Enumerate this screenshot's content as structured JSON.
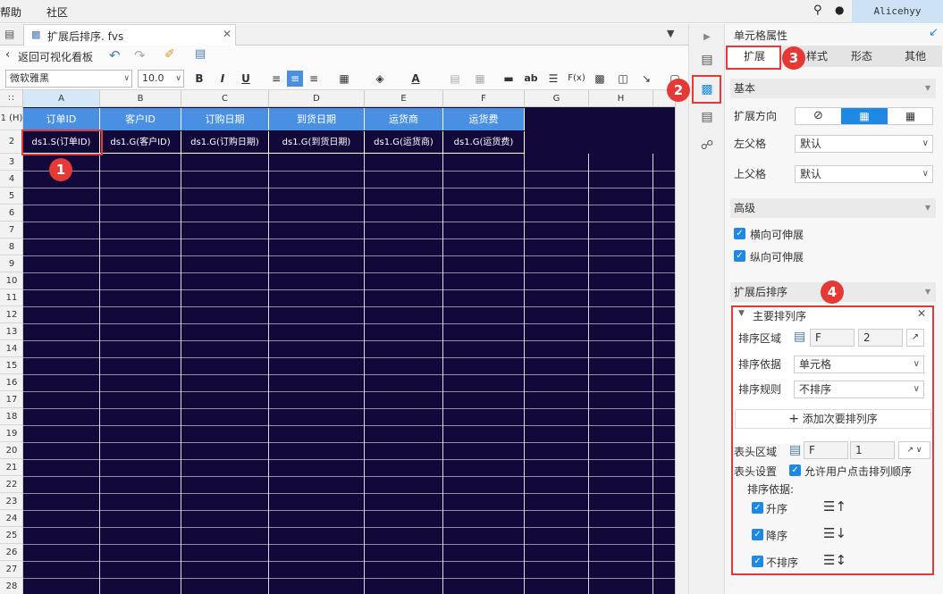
{
  "menubar": {
    "help": "帮助",
    "community": "社区",
    "user": "Alicehyy"
  },
  "tab": {
    "title": "扩展后排序. fvs"
  },
  "toolbar": {
    "back_label": "返回可视化看板",
    "font_name": "微软雅黑",
    "font_size": "10.0",
    "bold": "B",
    "italic": "I",
    "underline": "U",
    "text_a": "A",
    "ab": "ab",
    "fx": "F(x)"
  },
  "grid": {
    "columns": [
      "A",
      "B",
      "C",
      "D",
      "E",
      "F",
      "G",
      "H"
    ],
    "rows": [
      "1 (H)",
      "2",
      "3",
      "4",
      "5",
      "6",
      "7",
      "8",
      "9",
      "10",
      "11",
      "12",
      "13",
      "14",
      "15",
      "16",
      "17",
      "18",
      "19",
      "20",
      "21",
      "22",
      "23",
      "24",
      "25",
      "26",
      "27",
      "28"
    ],
    "header_cells": [
      "订单ID",
      "客户ID",
      "订购日期",
      "到货日期",
      "运货商",
      "运货费"
    ],
    "data_cells": [
      "ds1.S(订单ID)",
      "ds1.G(客户ID)",
      "ds1.G(订购日期)",
      "ds1.G(到货日期)",
      "ds1.G(运货商)",
      "ds1.G(运货费)"
    ]
  },
  "panel": {
    "title": "单元格属性",
    "tabs": [
      "扩展",
      "样式",
      "形态",
      "其他"
    ],
    "basic": {
      "section": "基本",
      "expand_dir_label": "扩展方向",
      "left_parent_label": "左父格",
      "left_parent_value": "默认",
      "top_parent_label": "上父格",
      "top_parent_value": "默认"
    },
    "advanced": {
      "section": "高级",
      "horizontal": "横向可伸展",
      "vertical": "纵向可伸展"
    },
    "sort": {
      "section": "扩展后排序",
      "primary": "主要排列序",
      "area_label": "排序区域",
      "area_col": "F",
      "area_row": "2",
      "basis_label": "排序依据",
      "basis_value": "单元格",
      "rule_label": "排序规则",
      "rule_value": "不排序",
      "add_secondary": "添加次要排列序",
      "header_area_label": "表头区域",
      "header_area_col": "F",
      "header_area_row": "1",
      "header_settings_label": "表头设置",
      "allow_user_sort": "允许用户点击排列顺序",
      "sort_basis": "排序依据:",
      "asc": "升序",
      "desc": "降序",
      "none": "不排序"
    }
  },
  "badges": [
    "1",
    "2",
    "3",
    "4"
  ],
  "colors": {
    "header_blue": "#4a90e2",
    "grid_bg": "#13083a",
    "accent": "#1e88e5",
    "callout": "#e53935"
  }
}
